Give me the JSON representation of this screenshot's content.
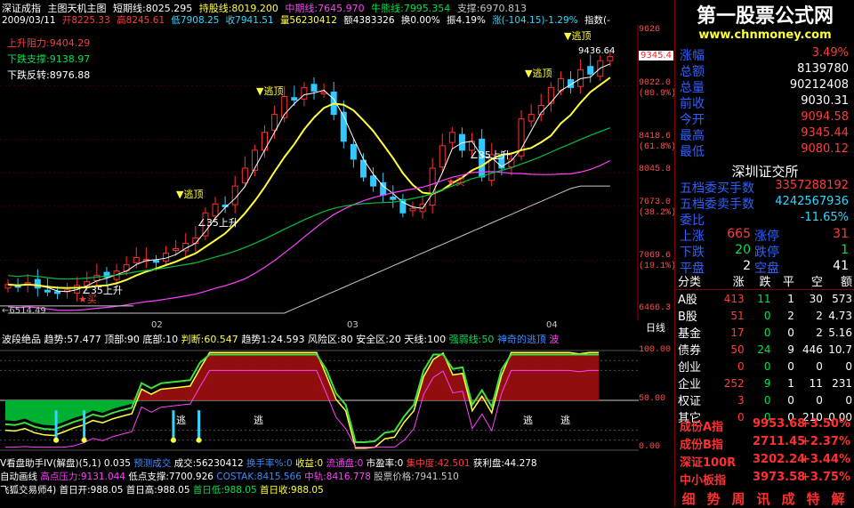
{
  "window": {
    "title": "深证成指",
    "subtitle": "主图天机主图"
  },
  "header": {
    "short": "短期线:8025.295",
    "hold": "持股线:8019.200",
    "mid": "中期线:7645.970",
    "bull": "牛熊线:7995.354",
    "support": "支撑:6970.813",
    "date": "2009/03/11",
    "open": "开8225.33",
    "high": "高8245.61",
    "low": "低7908.25",
    "close": "收7941.51",
    "vol": "量56230412",
    "amt": "额4383326",
    "turn": "换0.00%",
    "amp": "振4.19%",
    "change": "涨(-104.15)-1.29%",
    "idx": "指数(-"
  },
  "levels": {
    "up_resist": "上升阻力:9404.29",
    "down_support": "下跌支撑:9138.97",
    "down_rebound": "下跌反转:8976.88"
  },
  "price_axis": [
    "9626",
    "9022.0",
    "(80.9%)",
    "8418.6",
    "(61.8%)",
    "8045.8",
    "7673.0",
    "(38.2%)",
    "7069.6",
    "(19.1%)",
    "6466.3"
  ],
  "price_marker": "9345.4",
  "chart_annotations": {
    "escape": "逃顶",
    "up35": "35上升",
    "buy": "买",
    "peak_value": "9436.64",
    "low_value": "6514.49",
    "months": [
      "02",
      "03",
      "04"
    ],
    "day_line": "日线"
  },
  "sub": {
    "title": "波段绝品",
    "trend": "趋势:57.477",
    "top": "顶部:90",
    "bottom": "底部:10",
    "judge": "判断:60.547",
    "trend2": "趋势1:24.593",
    "risk": "风险区:80",
    "safe": "安全区:20",
    "sky": "天线:100",
    "strong": "强弱线:50",
    "extra": "神奇的逃顶",
    "extra2": "波",
    "axis": [
      "100.00",
      "50.00",
      "0.00"
    ],
    "escape": "逃"
  },
  "bottom": {
    "line1": [
      "V看盘助手IV(解盘)(5,1) 0.035",
      "预测成交",
      "成交:56230412",
      "换手率%:0",
      "收益:0",
      "流通盘:0",
      "市盈率:0",
      "集中度:42.501",
      "获利盘:44.278"
    ],
    "line2": [
      "自动画线",
      "高点压力:9131.044",
      "低点支撑:7700.926",
      "COSTAK:8415.566",
      "中轨:8416.778",
      "股票价格:7941.510"
    ],
    "line3": [
      "飞狐交易师4)",
      "首日开:988.05",
      "首日高:988.05",
      "首日低:988.05",
      "首日收:988.05"
    ]
  },
  "watermark": {
    "title": "第一股票公式网",
    "url": "www.chnmoney.com"
  },
  "panel": {
    "top_rows": [
      {
        "k": "涨幅",
        "v": "3.49%",
        "c": "#ff3b3b"
      },
      {
        "k": "总额",
        "v": "8139780",
        "c": "#ffffff"
      },
      {
        "k": "总量",
        "v": "90212408",
        "c": "#ffffff"
      },
      {
        "k": "前收",
        "v": "9030.31",
        "c": "#ffffff"
      },
      {
        "k": "今开",
        "v": "9094.58",
        "c": "#ff3b3b"
      },
      {
        "k": "最高",
        "v": "9345.44",
        "c": "#ff3b3b"
      },
      {
        "k": "最低",
        "v": "9080.12",
        "c": "#ff3b3b"
      }
    ],
    "exchange": "深圳证交所",
    "ex_rows": [
      {
        "k": "五档委买手数",
        "v": "3357288192",
        "c": "#ff3b3b"
      },
      {
        "k": "五档委卖手数",
        "v": "4242567936",
        "c": "#30d8ff"
      },
      {
        "k": "委比",
        "v": "-11.65%",
        "c": "#30d8ff"
      }
    ],
    "breadth": [
      {
        "k1": "上涨",
        "v1": "665",
        "k2": "涨停",
        "v2": "31",
        "c": "#ff3b3b"
      },
      {
        "k1": "下跌",
        "v1": "20",
        "k2": "跌停",
        "v2": "1",
        "c": "#00e050"
      },
      {
        "k1": "平盘",
        "v1": "2",
        "k2": "空盘",
        "v2": "41",
        "c": "#ffffff"
      }
    ],
    "table_head": [
      "分类",
      "涨",
      "跌",
      "平",
      "空",
      "额"
    ],
    "table_rows": [
      [
        "A股",
        "413",
        "11",
        "1",
        "30",
        "573"
      ],
      [
        "B股",
        "51",
        "0",
        "2",
        "2",
        "4.73"
      ],
      [
        "基金",
        "17",
        "0",
        "0",
        "2",
        "5.16"
      ],
      [
        "债券",
        "50",
        "24",
        "9",
        "446",
        "10.7"
      ],
      [
        "创业",
        "0",
        "0",
        "0",
        "0",
        "0"
      ],
      [
        "企业",
        "252",
        "9",
        "1",
        "11",
        "231"
      ],
      [
        "权证",
        "3",
        "0",
        "0",
        "0",
        "0"
      ],
      [
        "其它",
        "0",
        "0",
        "0",
        "210",
        "0.00"
      ]
    ],
    "indices": [
      {
        "k": "成份A指",
        "v": "9953.68",
        "p": "+3.50%"
      },
      {
        "k": "成份B指",
        "v": "2711.45",
        "p": "+2.37%"
      },
      {
        "k": "深证100R",
        "v": "3202.24",
        "p": "+3.44%"
      },
      {
        "k": "中小板指",
        "v": "3973.58",
        "p": "+3.75%"
      }
    ],
    "tabs": [
      "细",
      "势",
      "周",
      "讯",
      "成",
      "特",
      "解"
    ]
  },
  "chart_data": {
    "type": "candlestick",
    "days": 62,
    "closes": [
      6800,
      6780,
      6820,
      6760,
      6720,
      6700,
      6740,
      6790,
      6830,
      6900,
      6880,
      6950,
      7020,
      7100,
      7080,
      7050,
      7150,
      7200,
      7260,
      7320,
      7600,
      7700,
      7680,
      7900,
      8100,
      8300,
      8500,
      8700,
      8900,
      8860,
      9000,
      8960,
      8950,
      8700,
      8400,
      8200,
      8000,
      7900,
      7800,
      7750,
      7600,
      7650,
      7700,
      8100,
      8350,
      8500,
      8300,
      8400,
      8000,
      8250,
      8100,
      8200,
      8650,
      8700,
      8800,
      9000,
      9100,
      9000,
      9200,
      9150,
      9300,
      9345
    ]
  }
}
